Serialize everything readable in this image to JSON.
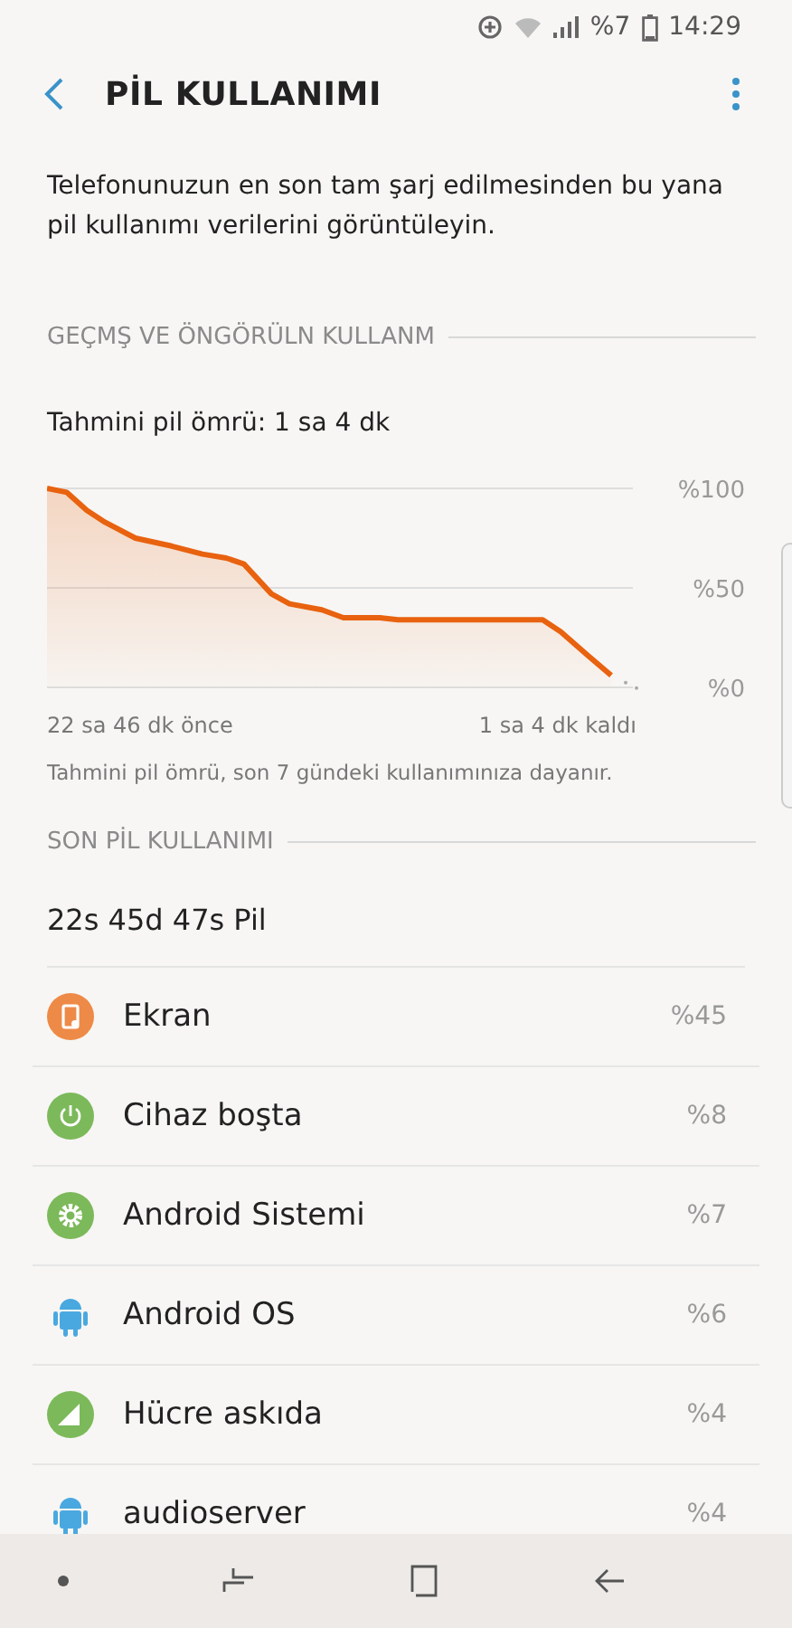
{
  "status_bar": {
    "battery_text": "%7",
    "time": "14:29"
  },
  "header": {
    "title": "PİL KULLANIMI"
  },
  "description": "Telefonunuzun en son tam şarj edilmesinden bu yana pil kullanımı verilerini görüntüleyin.",
  "history_section": {
    "heading": "GEÇMŞ VE ÖNGÖRÜLN KULLANM",
    "estimate": "Tahmini pil ömrü: 1 sa 4 dk",
    "y_axis_labels": [
      "%100",
      "%50",
      "%0"
    ],
    "x_axis_labels": [
      "22 sa 46 dk önce",
      "1 sa 4 dk kaldı"
    ],
    "note": "Tahmini pil ömrü, son 7 gündeki kullanımınıza dayanır."
  },
  "usage_section": {
    "heading": "SON PİL KULLANIMI",
    "summary": "22s 45d 47s Pil",
    "items": [
      {
        "name": "Ekran",
        "percent": "%45",
        "kind": "screen",
        "color": "#ee8a47"
      },
      {
        "name": "Cihaz boşta",
        "percent": "%8",
        "kind": "idle",
        "color": "#7cb95a"
      },
      {
        "name": "Android Sistemi",
        "percent": "%7",
        "kind": "system",
        "color": "#7cb95a"
      },
      {
        "name": "Android OS",
        "percent": "%6",
        "kind": "android",
        "color": "#4aa8e0"
      },
      {
        "name": "Hücre askıda",
        "percent": "%4",
        "kind": "cell",
        "color": "#7cb95a"
      },
      {
        "name": "audioserver",
        "percent": "%4",
        "kind": "android",
        "color": "#4aa8e0"
      }
    ]
  }
}
